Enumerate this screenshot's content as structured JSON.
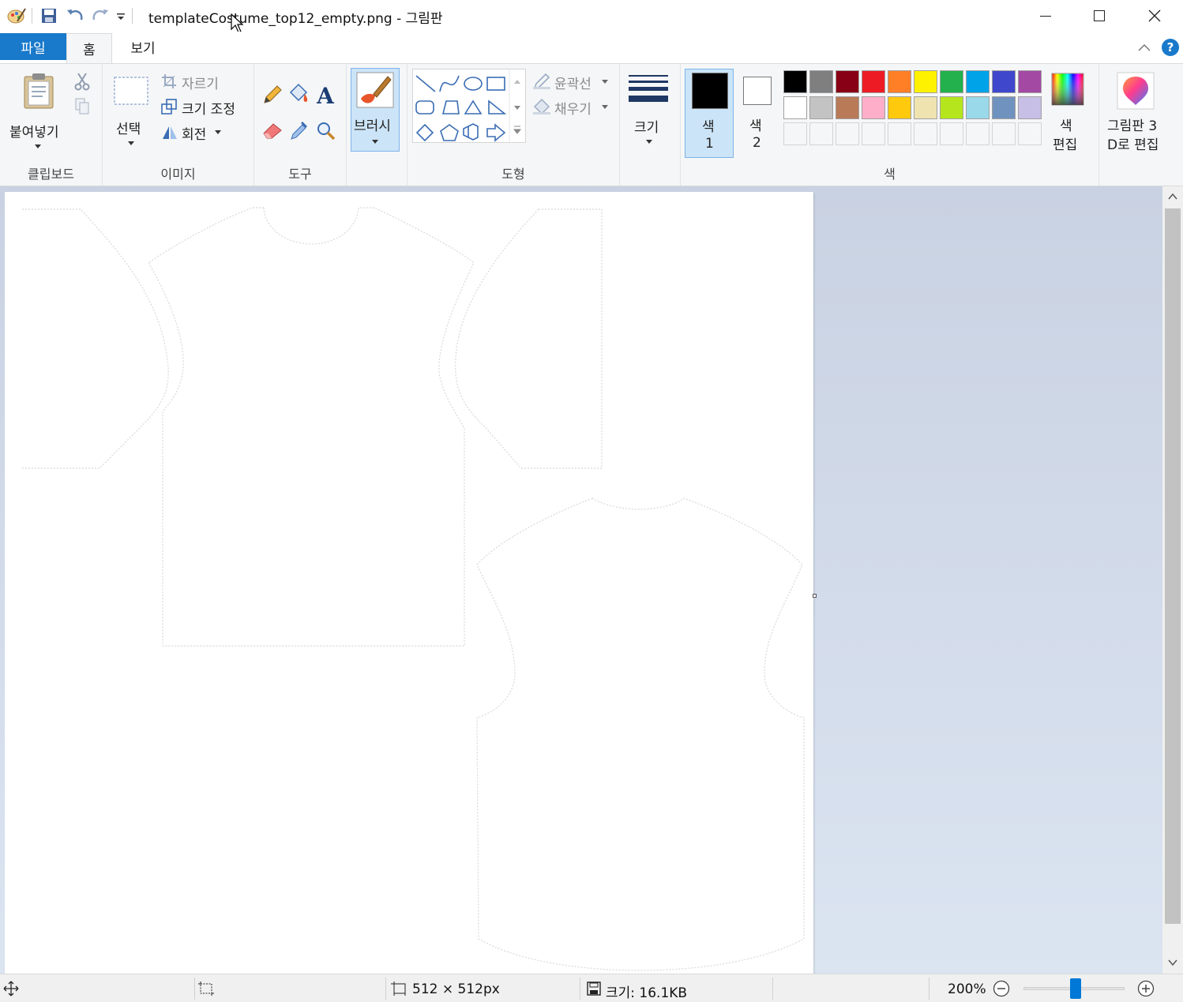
{
  "window": {
    "title": "templateCostume_top12_empty.png - 그림판"
  },
  "tabs": {
    "file": "파일",
    "home": "홈",
    "view": "보기"
  },
  "clipboard": {
    "paste": "붙여넣기",
    "group": "클립보드"
  },
  "image": {
    "select": "선택",
    "crop": "자르기",
    "resize": "크기 조정",
    "rotate": "회전",
    "group": "이미지"
  },
  "tools": {
    "group": "도구"
  },
  "brushes": {
    "label": "브러시"
  },
  "shapes": {
    "outline": "윤곽선",
    "fill": "채우기",
    "group": "도형"
  },
  "size": {
    "label": "크기"
  },
  "colors": {
    "color1_label": "색",
    "color1_num": "1",
    "color2_label": "색",
    "color2_num": "2",
    "edit_line1": "색",
    "edit_line2": "편집",
    "group": "색",
    "color1_value": "#000000",
    "color2_value": "#ffffff",
    "palette_row1": [
      "#000000",
      "#7f7f7f",
      "#880015",
      "#ed1c24",
      "#ff7f27",
      "#fff200",
      "#22b14c",
      "#00a2e8",
      "#3f48cc",
      "#a349a4"
    ],
    "palette_row2": [
      "#ffffff",
      "#c3c3c3",
      "#b97a57",
      "#ffaec9",
      "#ffc90e",
      "#efe4b0",
      "#b5e61d",
      "#99d9ea",
      "#7092be",
      "#c8bfe7"
    ]
  },
  "paint3d": {
    "line1": "그림판 3",
    "line2": "D로 편집"
  },
  "status": {
    "dimensions": "512 × 512px",
    "file_size": "크기: 16.1KB",
    "zoom": "200%",
    "zoom_level_fraction": 0.45
  }
}
